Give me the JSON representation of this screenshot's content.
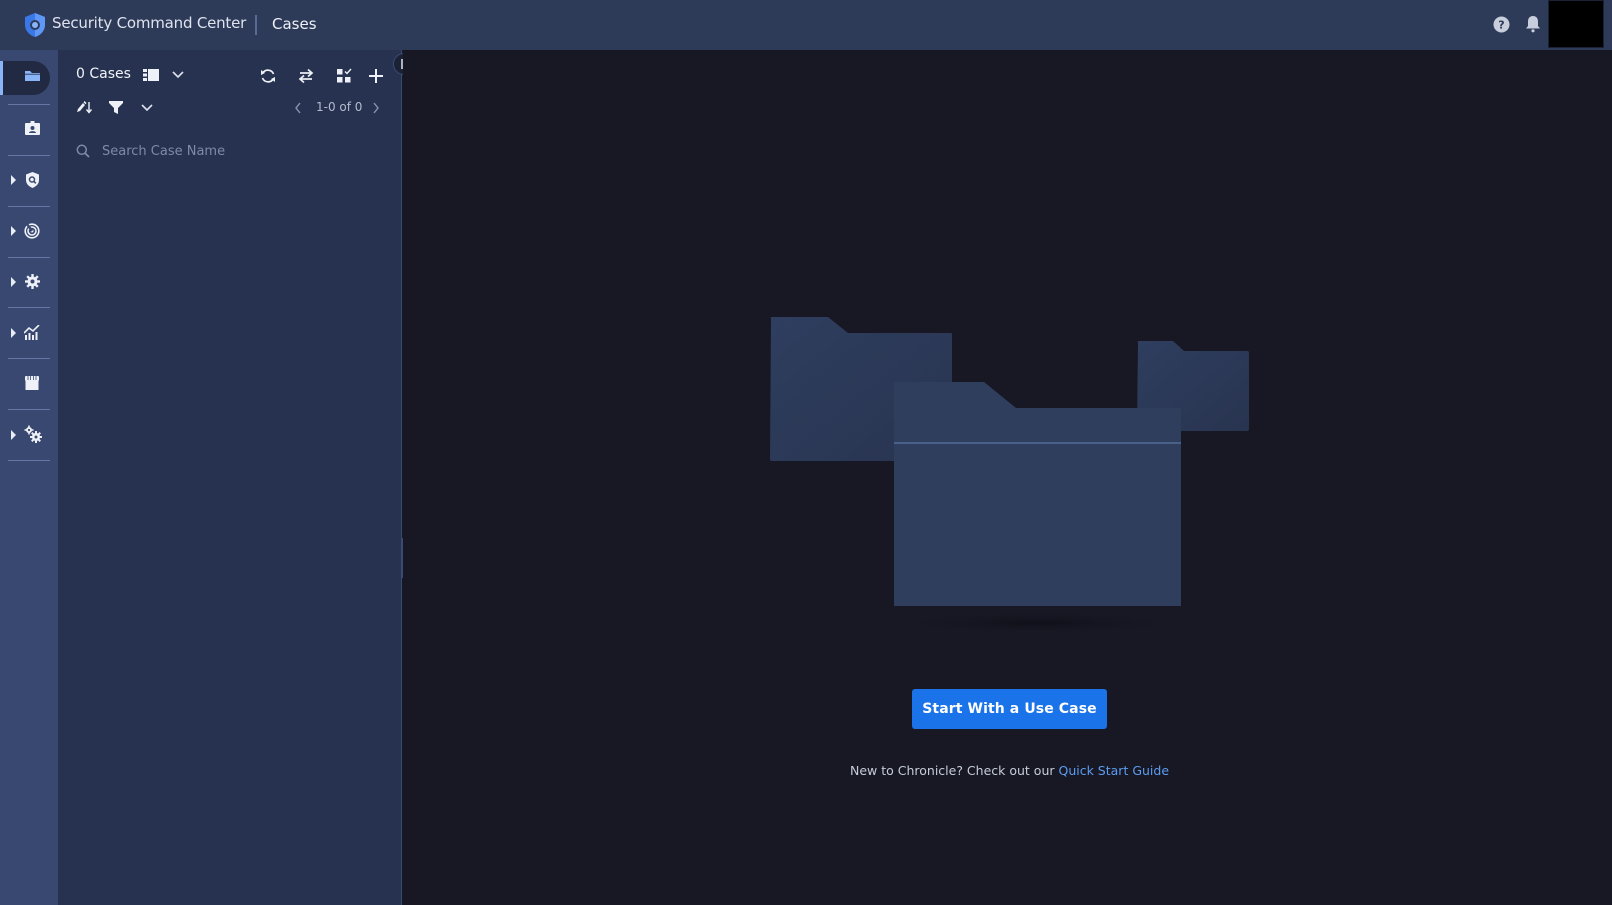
{
  "header": {
    "app_title": "Security Command Center",
    "page_title": "Cases",
    "icons": [
      "shield-logo-icon",
      "help-icon",
      "notifications-bell-icon"
    ],
    "avatar": "user-avatar"
  },
  "rail": {
    "items": [
      {
        "name": "cases",
        "icon": "folder-icon",
        "active": true,
        "expandable": false
      },
      {
        "name": "profile",
        "icon": "id-badge-icon",
        "active": false,
        "expandable": false
      },
      {
        "name": "investigation",
        "icon": "shield-search-icon",
        "active": false,
        "expandable": true
      },
      {
        "name": "detection",
        "icon": "radar-icon",
        "active": false,
        "expandable": true
      },
      {
        "name": "response",
        "icon": "gear-icon",
        "active": false,
        "expandable": true
      },
      {
        "name": "dashboards",
        "icon": "chart-icon",
        "active": false,
        "expandable": true
      },
      {
        "name": "marketplace",
        "icon": "storefront-icon",
        "active": false,
        "expandable": false
      },
      {
        "name": "settings",
        "icon": "gears-icon",
        "active": false,
        "expandable": true
      }
    ]
  },
  "cases_panel": {
    "count_label": "0 Cases",
    "pagination": "1-0 of 0",
    "search": {
      "placeholder": "Search Case Name",
      "value": ""
    },
    "toolbar_icons": [
      "view-toggle-icon",
      "chevron-down-icon",
      "refresh-icon",
      "swap-icon",
      "select-all-icon",
      "add-icon",
      "sort-icon",
      "filter-icon",
      "chevron-down-icon"
    ]
  },
  "empty_state": {
    "button_label": "Start With a Use Case",
    "hint_text": "New to Chronicle? Check out our ",
    "hint_link": "Quick Start Guide"
  },
  "colors": {
    "accent": "#1a73e8",
    "link": "#5b9cf0",
    "header_bg": "#2d3a58",
    "rail_bg": "#394870",
    "panel_bg": "#26324f",
    "main_bg": "#181824",
    "active_indicator": "#8ab4f8"
  }
}
